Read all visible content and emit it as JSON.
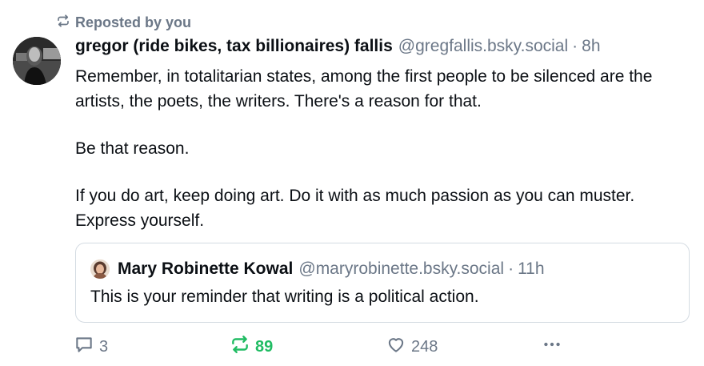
{
  "repost_indicator": {
    "label": "Reposted by you",
    "icon": "repost-icon",
    "color": "#6b7787"
  },
  "post": {
    "author_name": "gregor (ride bikes, tax billionaires) fallis",
    "handle": "@gregfallis.bsky.social",
    "separator": "·",
    "time": "8h",
    "paragraphs": [
      "Remember, in totalitarian states, among the first people to be silenced are the artists, the poets, the writers. There's a reason for that.",
      "Be that reason.",
      "If you do art, keep doing art. Do it with as much passion as you can muster. Express yourself."
    ]
  },
  "quoted_post": {
    "author_name": "Mary Robinette Kowal",
    "handle": "@maryrobinette.bsky.social",
    "separator": "·",
    "time": "11h",
    "text": "This is your reminder that writing is a political action."
  },
  "actions": {
    "reply": {
      "icon": "reply-icon",
      "count": "3"
    },
    "repost": {
      "icon": "repost-icon",
      "count": "89",
      "active": true,
      "color": "#20bc63"
    },
    "like": {
      "icon": "heart-icon",
      "count": "248"
    },
    "more": {
      "icon": "more-options-icon"
    }
  }
}
